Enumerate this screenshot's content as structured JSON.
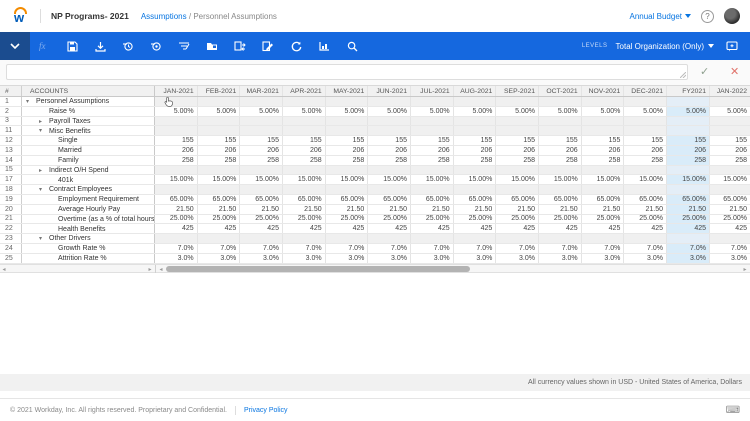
{
  "app": {
    "brand_letter": "w",
    "title": "NP Programs- 2021",
    "breadcrumb": {
      "section": "Assumptions",
      "separator": "/",
      "page": "Personnel Assumptions"
    },
    "version_label": "Annual Budget",
    "help_label": "?"
  },
  "toolbar": {
    "levels_label": "LEVELS",
    "levels_value": "Total Organization (Only)",
    "icons": [
      "collapse-toolbar",
      "formula-fx",
      "save",
      "import-download",
      "history-back",
      "history-forward",
      "filter-edit",
      "new-folder-sheet",
      "sheet-sync",
      "sheet-notes",
      "refresh",
      "chart",
      "search",
      "comments"
    ]
  },
  "formula_bar": {
    "value": "",
    "confirm_glyph": "✓",
    "cancel_glyph": "✕"
  },
  "grid": {
    "row_num_header": "#",
    "accounts_header": "ACCOUNTS",
    "columns": [
      "JAN-2021",
      "FEB-2021",
      "MAR-2021",
      "APR-2021",
      "MAY-2021",
      "JUN-2021",
      "JUL-2021",
      "AUG-2021",
      "SEP-2021",
      "OCT-2021",
      "NOV-2021",
      "DEC-2021",
      "FY2021",
      "JAN-2022"
    ],
    "highlight_column": "FY2021",
    "rows": [
      {
        "num": "1",
        "label": "Personnel Assumptions",
        "indent": 1,
        "caret": "down",
        "group": true,
        "value": ""
      },
      {
        "num": "2",
        "label": "Raise %",
        "indent": 2,
        "caret": null,
        "group": false,
        "value": "5.00%"
      },
      {
        "num": "3",
        "label": "Payroll Taxes",
        "indent": 2,
        "caret": "right",
        "group": true,
        "value": ""
      },
      {
        "num": "11",
        "label": "Misc Benefits",
        "indent": 2,
        "caret": "down",
        "group": true,
        "value": ""
      },
      {
        "num": "12",
        "label": "Single",
        "indent": 3,
        "caret": null,
        "group": false,
        "value": "155"
      },
      {
        "num": "13",
        "label": "Married",
        "indent": 3,
        "caret": null,
        "group": false,
        "value": "206"
      },
      {
        "num": "14",
        "label": "Family",
        "indent": 3,
        "caret": null,
        "group": false,
        "value": "258"
      },
      {
        "num": "15",
        "label": "Indirect O/H Spend",
        "indent": 2,
        "caret": "right",
        "group": true,
        "value": ""
      },
      {
        "num": "17",
        "label": "401k",
        "indent": 3,
        "caret": null,
        "group": false,
        "value": "15.00%"
      },
      {
        "num": "18",
        "label": "Contract Employees",
        "indent": 2,
        "caret": "down",
        "group": true,
        "value": ""
      },
      {
        "num": "19",
        "label": "Employment Requirement",
        "indent": 3,
        "caret": null,
        "group": false,
        "value": "65.00%"
      },
      {
        "num": "20",
        "label": "Average Hourly Pay",
        "indent": 3,
        "caret": null,
        "group": false,
        "value": "21.50"
      },
      {
        "num": "21",
        "label": "Overtime (as a % of total hours)",
        "indent": 3,
        "caret": null,
        "group": false,
        "value": "25.00%"
      },
      {
        "num": "22",
        "label": "Health Benefits",
        "indent": 3,
        "caret": null,
        "group": false,
        "value": "425"
      },
      {
        "num": "23",
        "label": "Other Drivers",
        "indent": 2,
        "caret": "down",
        "group": true,
        "value": ""
      },
      {
        "num": "24",
        "label": "Growth Rate %",
        "indent": 3,
        "caret": null,
        "group": false,
        "value": "7.0%"
      },
      {
        "num": "25",
        "label": "Attrition Rate %",
        "indent": 3,
        "caret": null,
        "group": false,
        "value": "3.0%"
      }
    ]
  },
  "footer": {
    "currency_note": "All currency values shown in USD - United States of America, Dollars",
    "copyright": "© 2021 Workday, Inc. All rights reserved. Proprietary and Confidential.",
    "privacy_label": "Privacy Policy"
  },
  "colors": {
    "toolbar_blue": "#1568df",
    "toolbar_dark_blue": "#1b4c8f",
    "link_blue": "#0875e1",
    "fy_highlight": "#d9ecf9",
    "brand_orange": "#f38b00",
    "brand_blue": "#005cb9"
  }
}
